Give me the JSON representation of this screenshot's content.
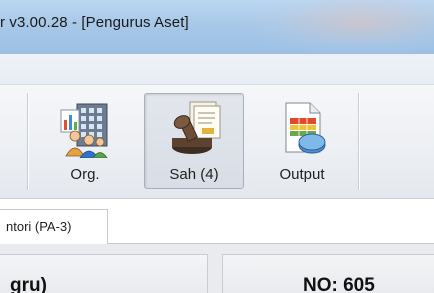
{
  "window": {
    "title": "r v3.00.28 - [Pengurus Aset]"
  },
  "toolbar": {
    "buttons": [
      {
        "label": "Org.",
        "icon": "organization-icon",
        "pressed": false
      },
      {
        "label": "Sah (4)",
        "icon": "approval-stamp-icon",
        "pressed": true
      },
      {
        "label": "Output",
        "icon": "report-output-icon",
        "pressed": false
      }
    ]
  },
  "tabs": [
    {
      "label": "ntori (PA-3)",
      "active": true
    }
  ],
  "panels": {
    "left_text": "gru)",
    "right_text": "NO: 605"
  },
  "colors": {
    "titlebar": "#a8c8e8",
    "toolbar": "#eceff3",
    "content": "#e9ebee"
  }
}
